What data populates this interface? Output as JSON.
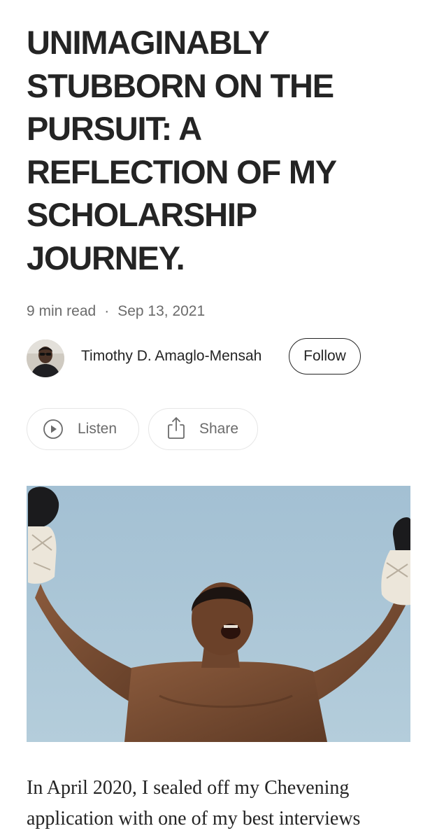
{
  "article": {
    "title": "UNIMAGINABLY\nSTUBBORN ON THE\nPURSUIT: A\nREFLECTION OF MY\nSCHOLARSHIP\nJOURNEY.",
    "read_time": "9 min read",
    "separator": "·",
    "date": "Sep 13, 2021"
  },
  "author": {
    "name": "Timothy D. Amaglo-Mensah",
    "follow_label": "Follow",
    "avatar_icon": "person-avatar"
  },
  "actions": {
    "listen_label": "Listen",
    "listen_icon": "play-circle-icon",
    "share_label": "Share",
    "share_icon": "share-icon"
  },
  "hero_image": {
    "subject": "boxer-celebrating-arms-raised"
  },
  "body": {
    "line1": "In April 2020, I sealed off my Chevening",
    "line2": "application with one of my best interviews"
  },
  "colors": {
    "text": "#242424",
    "muted": "#6b6b6b",
    "border": "#e6e6e6",
    "sky": "#a9c5d6"
  }
}
